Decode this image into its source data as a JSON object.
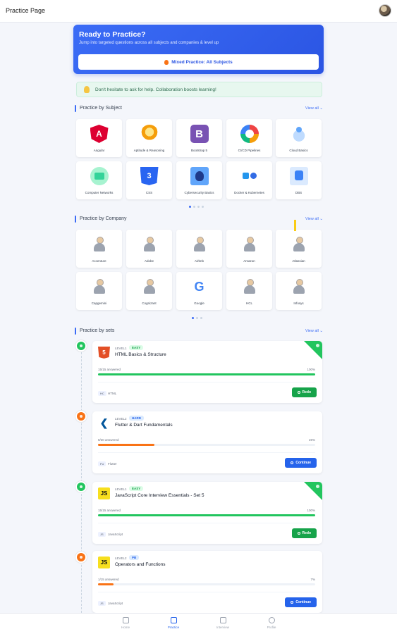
{
  "header": {
    "title": "Practice Page"
  },
  "hero": {
    "title": "Ready to Practice?",
    "subtitle": "Jump into targeted questions across all subjects and companies & level up",
    "button_label": "Mixed Practice: All Subjects"
  },
  "tip": {
    "text": "Don't hesitate to ask for help. Collaboration boosts learning!"
  },
  "subjects": {
    "title": "Practice by Subject",
    "view_all": "View all ⌄",
    "items": [
      {
        "label": "Angular",
        "icon": "angular-icon"
      },
      {
        "label": "Aptitude & Reasoning",
        "icon": "lightbulb-head-icon"
      },
      {
        "label": "Bootstrap 5",
        "icon": "bootstrap-icon"
      },
      {
        "label": "CI/CD Pipelines",
        "icon": "cicd-icon"
      },
      {
        "label": "Cloud Basics",
        "icon": "cloud-icon"
      },
      {
        "label": "Computer Networks",
        "icon": "network-icon"
      },
      {
        "label": "CSS",
        "icon": "css-icon"
      },
      {
        "label": "Cybersecurity Basics",
        "icon": "cybersecurity-icon"
      },
      {
        "label": "Docker & Kubernetes",
        "icon": "docker-kubernetes-icon"
      },
      {
        "label": "DBS",
        "icon": "database-icon"
      }
    ]
  },
  "companies": {
    "title": "Practice by Company",
    "view_all": "View all ⌄",
    "items": [
      {
        "label": "Accenture",
        "icon": "person-icon"
      },
      {
        "label": "Adobe",
        "icon": "person-icon"
      },
      {
        "label": "Airbnb",
        "icon": "person-icon"
      },
      {
        "label": "Amazon",
        "icon": "person-icon"
      },
      {
        "label": "Atlassian",
        "icon": "person-icon"
      },
      {
        "label": "Capgemini",
        "icon": "person-icon"
      },
      {
        "label": "Cognizant",
        "icon": "person-icon"
      },
      {
        "label": "Google",
        "icon": "google-icon"
      },
      {
        "label": "HCL",
        "icon": "person-icon"
      },
      {
        "label": "Infosys",
        "icon": "person-icon"
      }
    ]
  },
  "sets": {
    "title": "Practice by sets",
    "view_all": "View all ⌄",
    "items": [
      {
        "level": "LEVEL1",
        "badge": "EASY",
        "badge_kind": "easy",
        "name": "HTML Basics & Structure",
        "answered": "15/15 answered",
        "percent": "100%",
        "progress": 1.0,
        "tag": "HC",
        "tag_name": "HTML",
        "action": "Redo",
        "kind": "done",
        "icon": "html5-icon"
      },
      {
        "level": "LEVEL2",
        "badge": "HARD",
        "badge_kind": "hard",
        "name": "Flutter & Dart Fundamentals",
        "answered": "8/30 answered",
        "percent": "26%",
        "progress": 0.26,
        "tag": "FU",
        "tag_name": "Flutter",
        "action": "Continue",
        "kind": "progress",
        "icon": "flutter-icon"
      },
      {
        "level": "LEVEL1",
        "badge": "EASY",
        "badge_kind": "easy",
        "name": "JavaScript Core Interview Essentials - Set 5",
        "answered": "15/15 answered",
        "percent": "100%",
        "progress": 1.0,
        "tag": "JS",
        "tag_name": "JavaScript",
        "action": "Redo",
        "kind": "done",
        "icon": "javascript-icon"
      },
      {
        "level": "LEVEL2",
        "badge": "PB",
        "badge_kind": "hard",
        "name": "Operators and Functions",
        "answered": "1/15 answered",
        "percent": "7%",
        "progress": 0.07,
        "tag": "JS",
        "tag_name": "JavaScript",
        "action": "Continue",
        "kind": "progress",
        "icon": "javascript-icon"
      }
    ]
  },
  "bottom_nav": [
    {
      "label": "Home",
      "icon": "home-icon",
      "active": false
    },
    {
      "label": "Practice",
      "icon": "practice-icon",
      "active": true
    },
    {
      "label": "Interview",
      "icon": "interview-icon",
      "active": false
    },
    {
      "label": "Profile",
      "icon": "profile-icon",
      "active": false
    }
  ],
  "colors": {
    "accent": "#3b6cf6",
    "success": "#22c55e",
    "warning": "#f97316"
  }
}
